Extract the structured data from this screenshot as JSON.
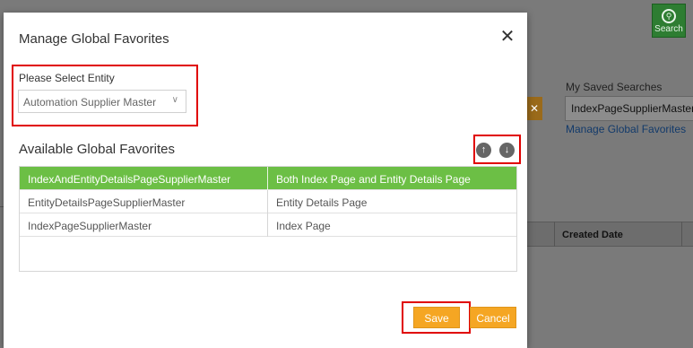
{
  "background": {
    "search_button_label": "Search",
    "search_icon": "magnifier-icon",
    "saved_searches_label": "My Saved Searches",
    "saved_search_value": "IndexPageSupplierMaster",
    "manage_link": "Manage Global Favorites",
    "clear_icon": "close-icon",
    "created_date_header": "Created Date"
  },
  "modal": {
    "title": "Manage Global Favorites",
    "close_icon": "close-icon",
    "entity_label": "Please Select Entity",
    "entity_value": "Automation Supplier Master",
    "favorites_heading": "Available Global Favorites",
    "move_up_icon": "arrow-up-icon",
    "move_down_icon": "arrow-down-icon",
    "rows": [
      {
        "name": "IndexAndEntityDetailsPageSupplierMaster",
        "scope": "Both Index Page and Entity Details Page",
        "selected": true
      },
      {
        "name": "EntityDetailsPageSupplierMaster",
        "scope": "Entity Details Page",
        "selected": false
      },
      {
        "name": "IndexPageSupplierMaster",
        "scope": "Index Page",
        "selected": false
      }
    ],
    "save_label": "Save",
    "cancel_label": "Cancel"
  },
  "colors": {
    "selected_row": "#6cbf45",
    "button_orange": "#f5a623",
    "highlight_red": "#e00000",
    "search_green": "#2e7d32"
  }
}
